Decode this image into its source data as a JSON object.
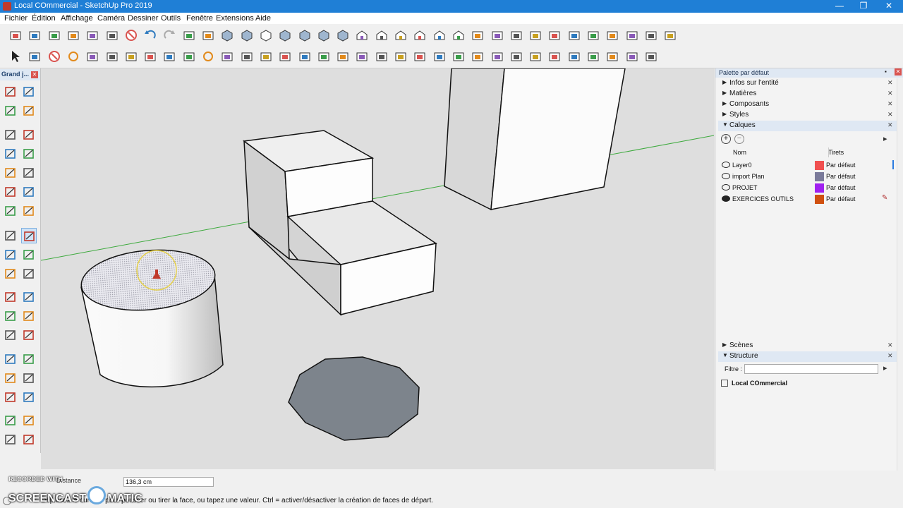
{
  "window": {
    "title": "Local COmmercial - SketchUp Pro 2019",
    "controls": {
      "minimize": "—",
      "maximize": "❐",
      "close": "✕"
    }
  },
  "menu": [
    "Fichier",
    "Édition",
    "Affichage",
    "Caméra",
    "Dessiner",
    "Outils",
    "Fenêtre",
    "Extensions",
    "Aide"
  ],
  "left_palette": {
    "title": "Grand j...",
    "close": "✕"
  },
  "tray": {
    "title": "Palette par défaut",
    "sections_collapsed": [
      "Infos sur l'entité",
      "Matières",
      "Composants",
      "Styles"
    ],
    "calques": {
      "label": "Calques",
      "col_name": "Nom",
      "col_dashes": "Tirets",
      "layers": [
        {
          "name": "Layer0",
          "color": "#f05050",
          "dashes": "Par défaut",
          "visible": false
        },
        {
          "name": "import Plan",
          "color": "#7a7a9a",
          "dashes": "Par défaut",
          "visible": false
        },
        {
          "name": "PROJET",
          "color": "#a020f0",
          "dashes": "Par défaut",
          "visible": false
        },
        {
          "name": "EXERCICES OUTILS",
          "color": "#d05010",
          "dashes": "Par défaut",
          "visible": true,
          "active": true
        }
      ]
    },
    "scenes": "Scènes",
    "structure": {
      "label": "Structure",
      "filter_label": "Filtre :",
      "filter_value": "",
      "root": "Local COmmercial"
    }
  },
  "status": {
    "measure_label": "Distance",
    "measure_value": "136,3 cm",
    "hint": "Déplacez le curseur pour pousser ou tirer la face, ou tapez une valeur.  Ctrl = activer/désactiver la création de faces de départ."
  },
  "watermark": {
    "line1": "RECORDED WITH",
    "line2": "SCREENCAST",
    "line3": "MATIC"
  },
  "icons": {
    "tb1": [
      "new-icon",
      "open-icon",
      "save-icon",
      "cut-icon",
      "copy-icon",
      "paste-icon",
      "erase-icon",
      "undo-icon",
      "redo-icon",
      "print-icon",
      "model-info-icon",
      "xray-icon",
      "back-edges-icon",
      "wireframe-icon",
      "hidden-line-icon",
      "shaded-icon",
      "shaded-textures-icon",
      "monochrome-icon",
      "iso-view-icon",
      "top-view-icon",
      "front-view-icon",
      "right-view-icon",
      "back-view-icon",
      "left-view-icon",
      "orbit-icon",
      "pan-icon",
      "zoom-icon",
      "zoom-extents-icon",
      "sandbox-contours-icon",
      "sandbox-scratch-icon",
      "sandbox-smoove-icon",
      "sandbox-stamp-icon",
      "sandbox-drape-icon",
      "sandbox-add-detail-icon",
      "sandbox-flip-edge-icon"
    ],
    "tb2": [
      "select-icon",
      "make-component-icon",
      "eraser-icon",
      "circle-icon",
      "paint-icon",
      "move-icon",
      "push-pull-icon",
      "rotate-icon",
      "follow-me-icon",
      "scale-icon",
      "offset-icon",
      "tape-measure-icon",
      "dimension-icon",
      "protractor-icon",
      "text-icon",
      "axes-icon",
      "3d-text-icon",
      "section-plane-icon",
      "display-section-planes-icon",
      "display-section-cuts-icon",
      "section-fill-icon",
      "warehouse-icon",
      "extension-warehouse-icon",
      "layout-icon",
      "extension-manager-icon",
      "outer-shell-icon",
      "intersect-icon",
      "union-icon",
      "subtract-icon",
      "trim-icon",
      "split-icon",
      "styles-icon",
      "shadows-icon",
      "fog-icon"
    ]
  }
}
